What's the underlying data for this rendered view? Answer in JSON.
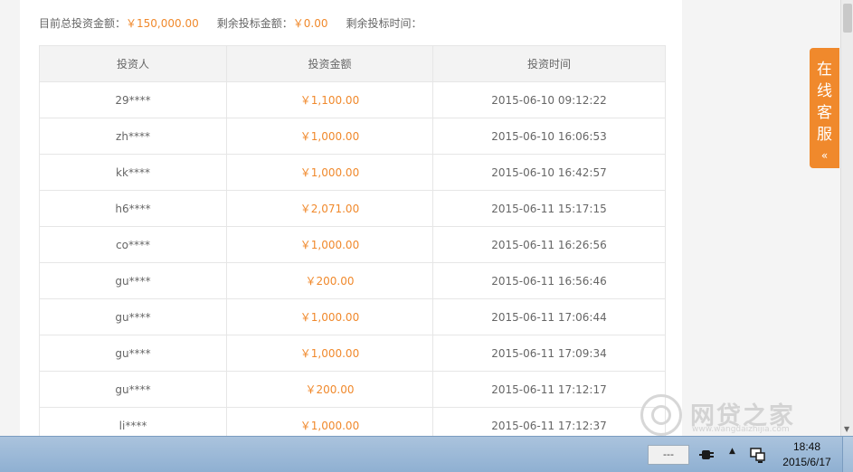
{
  "summary": {
    "total_label": "目前总投资金额：",
    "total_value": "￥150,000.00",
    "remaining_label": "剩余投标金额：",
    "remaining_value": "￥0.00",
    "time_label": "剩余投标时间："
  },
  "table": {
    "headers": [
      "投资人",
      "投资金额",
      "投资时间"
    ],
    "rows": [
      [
        "29****",
        "￥1,100.00",
        "2015-06-10 09:12:22"
      ],
      [
        "zh****",
        "￥1,000.00",
        "2015-06-10 16:06:53"
      ],
      [
        "kk****",
        "￥1,000.00",
        "2015-06-10 16:42:57"
      ],
      [
        "h6****",
        "￥2,071.00",
        "2015-06-11 15:17:15"
      ],
      [
        "co****",
        "￥1,000.00",
        "2015-06-11 16:26:56"
      ],
      [
        "gu****",
        "￥200.00",
        "2015-06-11 16:56:46"
      ],
      [
        "gu****",
        "￥1,000.00",
        "2015-06-11 17:06:44"
      ],
      [
        "gu****",
        "￥1,000.00",
        "2015-06-11 17:09:34"
      ],
      [
        "gu****",
        "￥200.00",
        "2015-06-11 17:12:17"
      ],
      [
        "li****",
        "￥1,000.00",
        "2015-06-11 17:12:37"
      ]
    ]
  },
  "service_tab": {
    "chars": [
      "在",
      "线",
      "客",
      "服"
    ],
    "chevron": "«"
  },
  "watermark": {
    "brand": "网贷之家",
    "url": "www.wangdaizhijia.com"
  },
  "taskbar": {
    "battery_text": "---",
    "time": "18:48",
    "date": "2015/6/17",
    "tray_expand": "▲"
  },
  "colors": {
    "accent": "#f0892c",
    "table_header_bg": "#f3f3f3",
    "border": "#e6e6e6",
    "text": "#666666"
  },
  "icons": [
    "chevron-left-double-icon",
    "scroll-down-arrow-icon",
    "power-plug-icon",
    "network-icon",
    "tray-expand-icon",
    "watermark-logo-icon"
  ]
}
